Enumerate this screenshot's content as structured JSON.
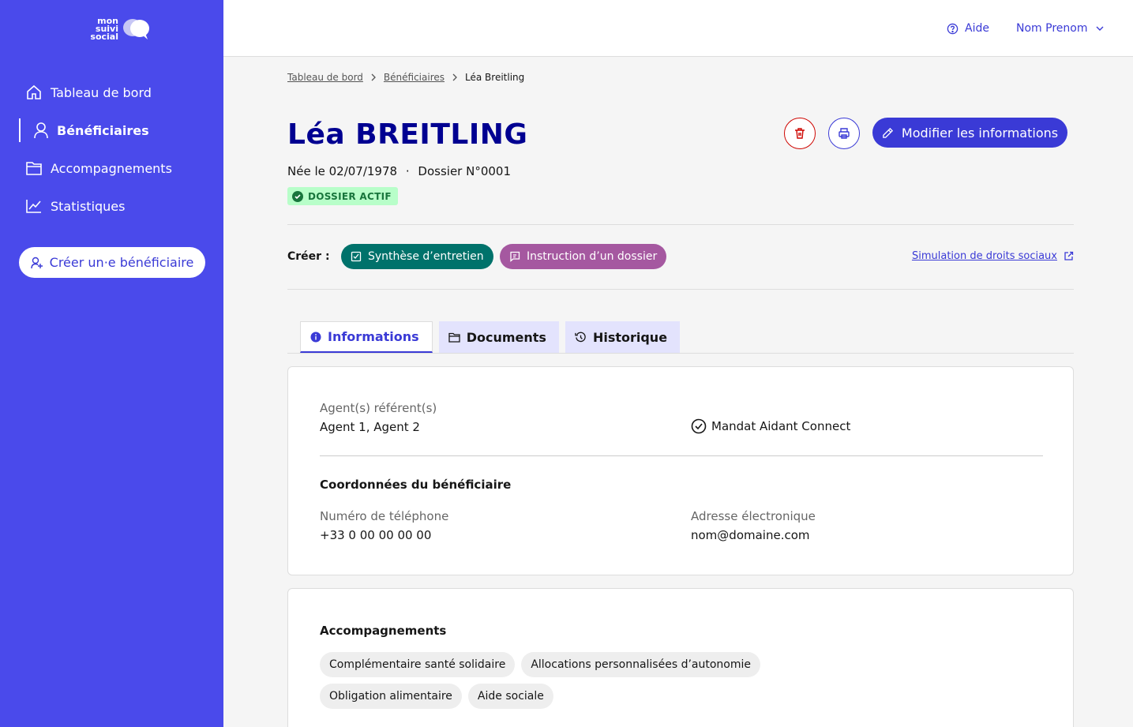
{
  "app": {
    "logo_line1": "mon suivi",
    "logo_line2": "social"
  },
  "sidebar": {
    "items": [
      {
        "label": "Tableau de bord",
        "icon": "home-icon"
      },
      {
        "label": "Bénéficiaires",
        "icon": "user-icon",
        "active": true
      },
      {
        "label": "Accompagnements",
        "icon": "folder-icon"
      },
      {
        "label": "Statistiques",
        "icon": "chart-line-icon"
      }
    ],
    "create_button": "Créer un·e bénéficiaire"
  },
  "header": {
    "help_label": "Aide",
    "user_label": "Nom Prenom"
  },
  "breadcrumb": {
    "items": [
      "Tableau de bord",
      "Bénéficiaires"
    ],
    "current": "Léa Breitling"
  },
  "beneficiary": {
    "name": "Léa BREITLING",
    "birth": "Née le 02/07/1978",
    "dot": "·",
    "file": "Dossier N°0001",
    "status": "DOSSIER ACTIF"
  },
  "actions": {
    "modify_label": "Modifier les informations"
  },
  "create_row": {
    "label": "Créer :",
    "synthese": "Synthèse d’entretien",
    "instruction": "Instruction d’un dossier",
    "simulation": "Simulation de droits sociaux"
  },
  "tabs": [
    {
      "label": "Informations",
      "active": true
    },
    {
      "label": "Documents"
    },
    {
      "label": "Historique"
    }
  ],
  "info": {
    "agents_label": "Agent(s) référent(s)",
    "agents_value": "Agent 1, Agent 2",
    "mandat": "Mandat Aidant Connect",
    "contact_title": "Coordonnées du bénéficiaire",
    "phone_label": "Numéro de téléphone",
    "phone_value": "+33 0 00 00 00 00",
    "email_label": "Adresse électronique",
    "email_value": "nom@domaine.com"
  },
  "accompagnements": {
    "title": "Accompagnements",
    "tags": [
      "Complémentaire santé solidaire",
      "Allocations personnalisées d’autonomie",
      "Obligation alimentaire",
      "Aide sociale"
    ]
  },
  "colors": {
    "sidebar": "#4a4aeb",
    "primary": "#3a3ad6",
    "title": "#000091",
    "danger": "#ce0500",
    "success_bg": "#b8fec9",
    "success_text": "#18753c",
    "synthese": "#00726b",
    "instruction": "#a558a0"
  }
}
